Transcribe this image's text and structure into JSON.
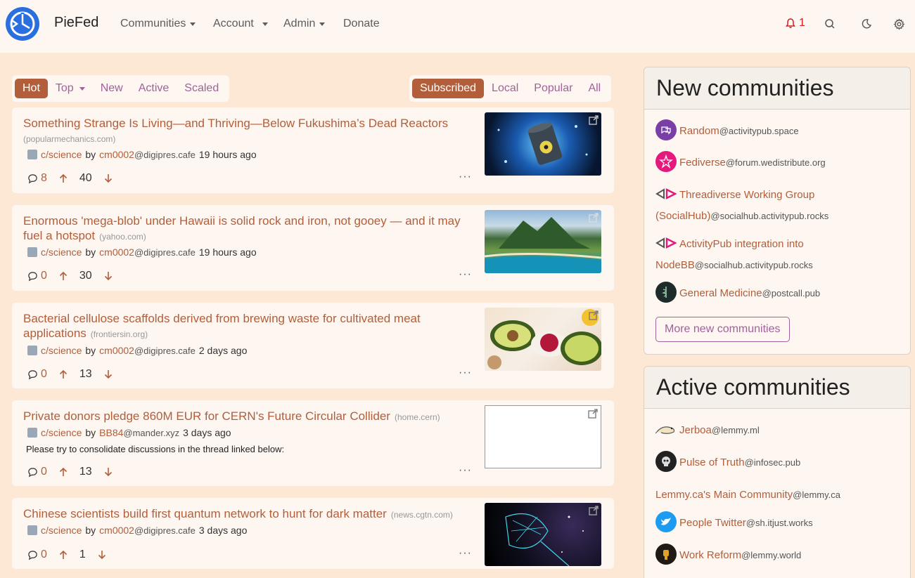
{
  "app": {
    "brand": "PieFed"
  },
  "nav": {
    "communities": "Communities",
    "account": "Account",
    "admin": "Admin",
    "donate": "Donate",
    "notifications_count": "1"
  },
  "sort_tabs": [
    "Hot",
    "Top",
    "New",
    "Active",
    "Scaled"
  ],
  "feed_tabs": [
    "Subscribed",
    "Local",
    "Popular",
    "All"
  ],
  "posts": [
    {
      "title": "Something Strange Is Living—and Thriving—Below Fukushima’s Dead Reactors",
      "domain": "(popularmechanics.com)",
      "community": "c/science",
      "by": "by",
      "user": "cm0002",
      "instance": "@digipres.cafe",
      "time": "19 hours ago",
      "body": "",
      "comments": "8",
      "score": "40"
    },
    {
      "title": "Enormous 'mega-blob' under Hawaii is solid rock and iron, not gooey — and it may fuel a hotspot",
      "domain": "(yahoo.com)",
      "community": "c/science",
      "by": "by",
      "user": "cm0002",
      "instance": "@digipres.cafe",
      "time": "19 hours ago",
      "body": "",
      "comments": "0",
      "score": "30"
    },
    {
      "title": "Bacterial cellulose scaffolds derived from brewing waste for cultivated meat applications",
      "domain": "(frontiersin.org)",
      "community": "c/science",
      "by": "by",
      "user": "cm0002",
      "instance": "@digipres.cafe",
      "time": "2 days ago",
      "body": "",
      "comments": "0",
      "score": "13"
    },
    {
      "title": "Private donors pledge 860M EUR for CERN's Future Circular Collider",
      "domain": "(home.cern)",
      "community": "c/science",
      "by": "by",
      "user": "BB84",
      "instance": "@mander.xyz",
      "time": "3 days ago",
      "body": "Please try to consolidate discussions in the thread linked below:",
      "comments": "0",
      "score": "13"
    },
    {
      "title": "Chinese scientists build first quantum network to hunt for dark matter",
      "domain": "(news.cgtn.com)",
      "community": "c/science",
      "by": "by",
      "user": "cm0002",
      "instance": "@digipres.cafe",
      "time": "3 days ago",
      "body": "",
      "comments": "0",
      "score": "1"
    }
  ],
  "new_communities": {
    "heading": "New communities",
    "items": [
      {
        "name": "Random",
        "instance": "@activitypub.space"
      },
      {
        "name": "Fediverse",
        "instance": "@forum.wedistribute.org"
      },
      {
        "name": "Threadiverse Working Group (SocialHub)",
        "instance": "@socialhub.activitypub.rocks"
      },
      {
        "name": "ActivityPub integration into NodeBB",
        "instance": "@socialhub.activitypub.rocks"
      },
      {
        "name": "General Medicine",
        "instance": "@postcall.pub"
      }
    ],
    "more_label": "More new communities"
  },
  "active_communities": {
    "heading": "Active communities",
    "items": [
      {
        "name": "Jerboa",
        "instance": "@lemmy.ml"
      },
      {
        "name": "Pulse of Truth",
        "instance": "@infosec.pub"
      },
      {
        "name": "Lemmy.ca's Main Community",
        "instance": "@lemmy.ca"
      },
      {
        "name": "People Twitter",
        "instance": "@sh.itjust.works"
      },
      {
        "name": "Work Reform",
        "instance": "@lemmy.world"
      }
    ]
  },
  "colors": {
    "accent": "#b25e3a",
    "link": "#a0629a",
    "background": "#fde8d6",
    "card": "#fdf6f1"
  }
}
